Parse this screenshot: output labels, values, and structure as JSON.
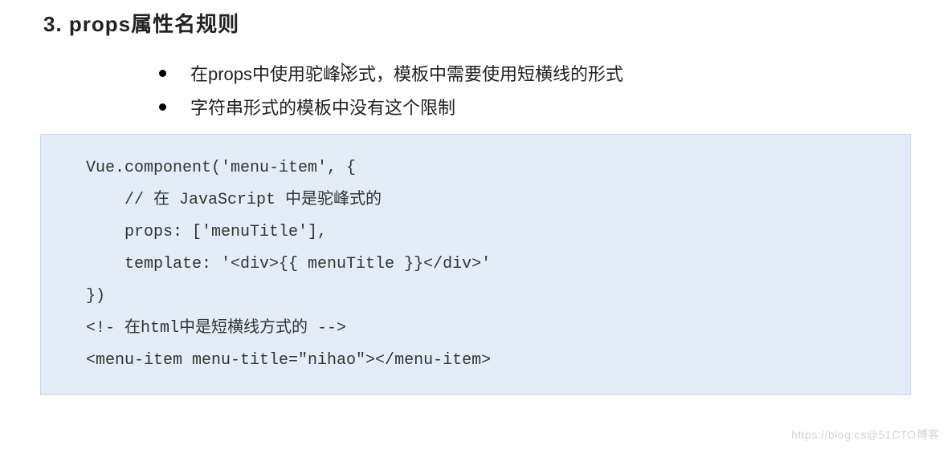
{
  "heading": "3.   props属性名规则",
  "bullets": [
    "在props中使用驼峰形式，模板中需要使用短横线的形式",
    "字符串形式的模板中没有这个限制"
  ],
  "code": "Vue.component('menu-item', {\n    // 在 JavaScript 中是驼峰式的\n    props: ['menuTitle'],\n    template: '<div>{{ menuTitle }}</div>'\n})\n<!- 在html中是短横线方式的 -->\n<menu-item menu-title=\"nihao\"></menu-item>",
  "watermark": "https://blog.cs@51CTO博客"
}
